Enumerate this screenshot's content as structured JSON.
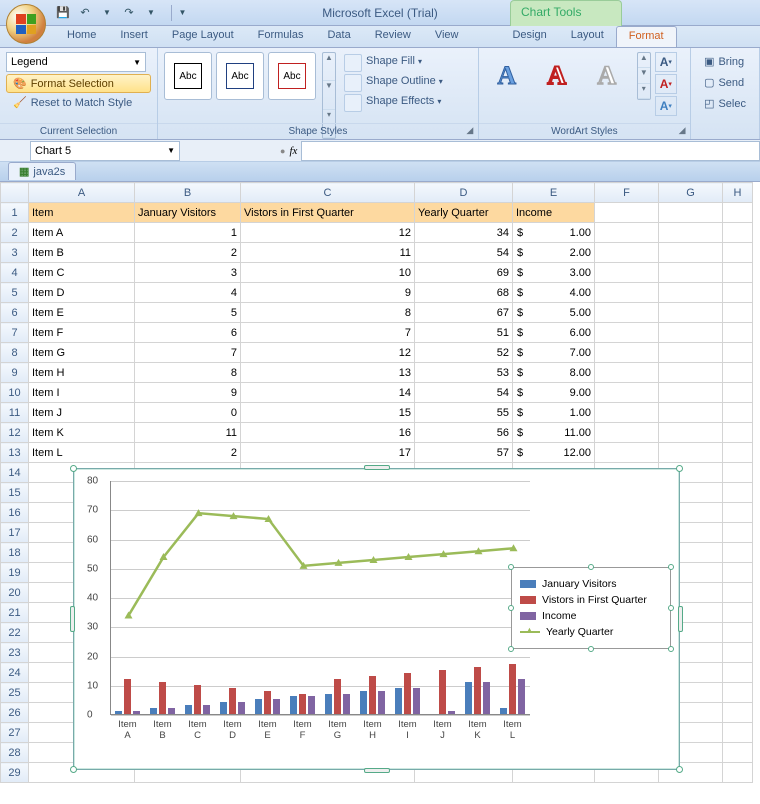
{
  "app": {
    "title": "Microsoft Excel (Trial)",
    "chart_tools": "Chart Tools"
  },
  "qat": {
    "save": "💾",
    "undo": "↶",
    "redo": "↷"
  },
  "tabs": [
    "Home",
    "Insert",
    "Page Layout",
    "Formulas",
    "Data",
    "Review",
    "View"
  ],
  "ctx_tabs": [
    "Design",
    "Layout",
    "Format"
  ],
  "active_ctx": "Format",
  "ribbon": {
    "sel_group": "Current Selection",
    "sel_dropdown": "Legend",
    "fmt_sel": "Format Selection",
    "reset": "Reset to Match Style",
    "shape_group": "Shape Styles",
    "shape_thumb": "Abc",
    "shape_fill": "Shape Fill",
    "shape_outline": "Shape Outline",
    "shape_effects": "Shape Effects",
    "wordart_group": "WordArt Styles",
    "wa_glyph": "A",
    "arr_bring": "Bring",
    "arr_send": "Send",
    "arr_select": "Selec"
  },
  "namebox": "Chart 5",
  "fx": "fx",
  "workbook_tab": "java2s",
  "columns": [
    "A",
    "B",
    "C",
    "D",
    "E",
    "F",
    "G",
    "H"
  ],
  "headers": {
    "A": "Item",
    "B": "January Visitors",
    "C": "Vistors in First Quarter",
    "D": "Yearly Quarter",
    "E": "Income"
  },
  "rows": [
    {
      "r": 1
    },
    {
      "r": 2,
      "A": "Item A",
      "B": 1,
      "C": 12,
      "D": 34,
      "E": "1.00"
    },
    {
      "r": 3,
      "A": "Item B",
      "B": 2,
      "C": 11,
      "D": 54,
      "E": "2.00"
    },
    {
      "r": 4,
      "A": "Item C",
      "B": 3,
      "C": 10,
      "D": 69,
      "E": "3.00"
    },
    {
      "r": 5,
      "A": "Item D",
      "B": 4,
      "C": 9,
      "D": 68,
      "E": "4.00"
    },
    {
      "r": 6,
      "A": "Item E",
      "B": 5,
      "C": 8,
      "D": 67,
      "E": "5.00"
    },
    {
      "r": 7,
      "A": "Item F",
      "B": 6,
      "C": 7,
      "D": 51,
      "E": "6.00"
    },
    {
      "r": 8,
      "A": "Item G",
      "B": 7,
      "C": 12,
      "D": 52,
      "E": "7.00"
    },
    {
      "r": 9,
      "A": "Item H",
      "B": 8,
      "C": 13,
      "D": 53,
      "E": "8.00"
    },
    {
      "r": 10,
      "A": "Item I",
      "B": 9,
      "C": 14,
      "D": 54,
      "E": "9.00"
    },
    {
      "r": 11,
      "A": "Item J",
      "B": 0,
      "C": 15,
      "D": 55,
      "E": "1.00"
    },
    {
      "r": 12,
      "A": "Item K",
      "B": 11,
      "C": 16,
      "D": 56,
      "E": "11.00"
    },
    {
      "r": 13,
      "A": "Item L",
      "B": 2,
      "C": 17,
      "D": 57,
      "E": "12.00"
    }
  ],
  "blank_rows": [
    14,
    15,
    16,
    17,
    18,
    19,
    20,
    21,
    22,
    23,
    24,
    25,
    26,
    27,
    28,
    29
  ],
  "chart_data": {
    "type": "combo",
    "categories": [
      "Item A",
      "Item B",
      "Item C",
      "Item D",
      "Item E",
      "Item F",
      "Item G",
      "Item H",
      "Item I",
      "Item J",
      "Item K",
      "Item L"
    ],
    "series": [
      {
        "name": "January Visitors",
        "type": "bar",
        "color": "#4a7ebb",
        "values": [
          1,
          2,
          3,
          4,
          5,
          6,
          7,
          8,
          9,
          0,
          11,
          2
        ]
      },
      {
        "name": "Vistors in First Quarter",
        "type": "bar",
        "color": "#be4b48",
        "values": [
          12,
          11,
          10,
          9,
          8,
          7,
          12,
          13,
          14,
          15,
          16,
          17
        ]
      },
      {
        "name": "Income",
        "type": "bar",
        "color": "#8064a2",
        "values": [
          1,
          2,
          3,
          4,
          5,
          6,
          7,
          8,
          9,
          1,
          11,
          12
        ]
      },
      {
        "name": "Yearly Quarter",
        "type": "line",
        "color": "#9bbb59",
        "values": [
          34,
          54,
          69,
          68,
          67,
          51,
          52,
          53,
          54,
          55,
          56,
          57
        ]
      }
    ],
    "ylim": [
      0,
      80
    ],
    "yticks": [
      0,
      10,
      20,
      30,
      40,
      50,
      60,
      70,
      80
    ],
    "legend": [
      "January Visitors",
      "Vistors in First Quarter",
      "Income",
      "Yearly Quarter"
    ]
  }
}
